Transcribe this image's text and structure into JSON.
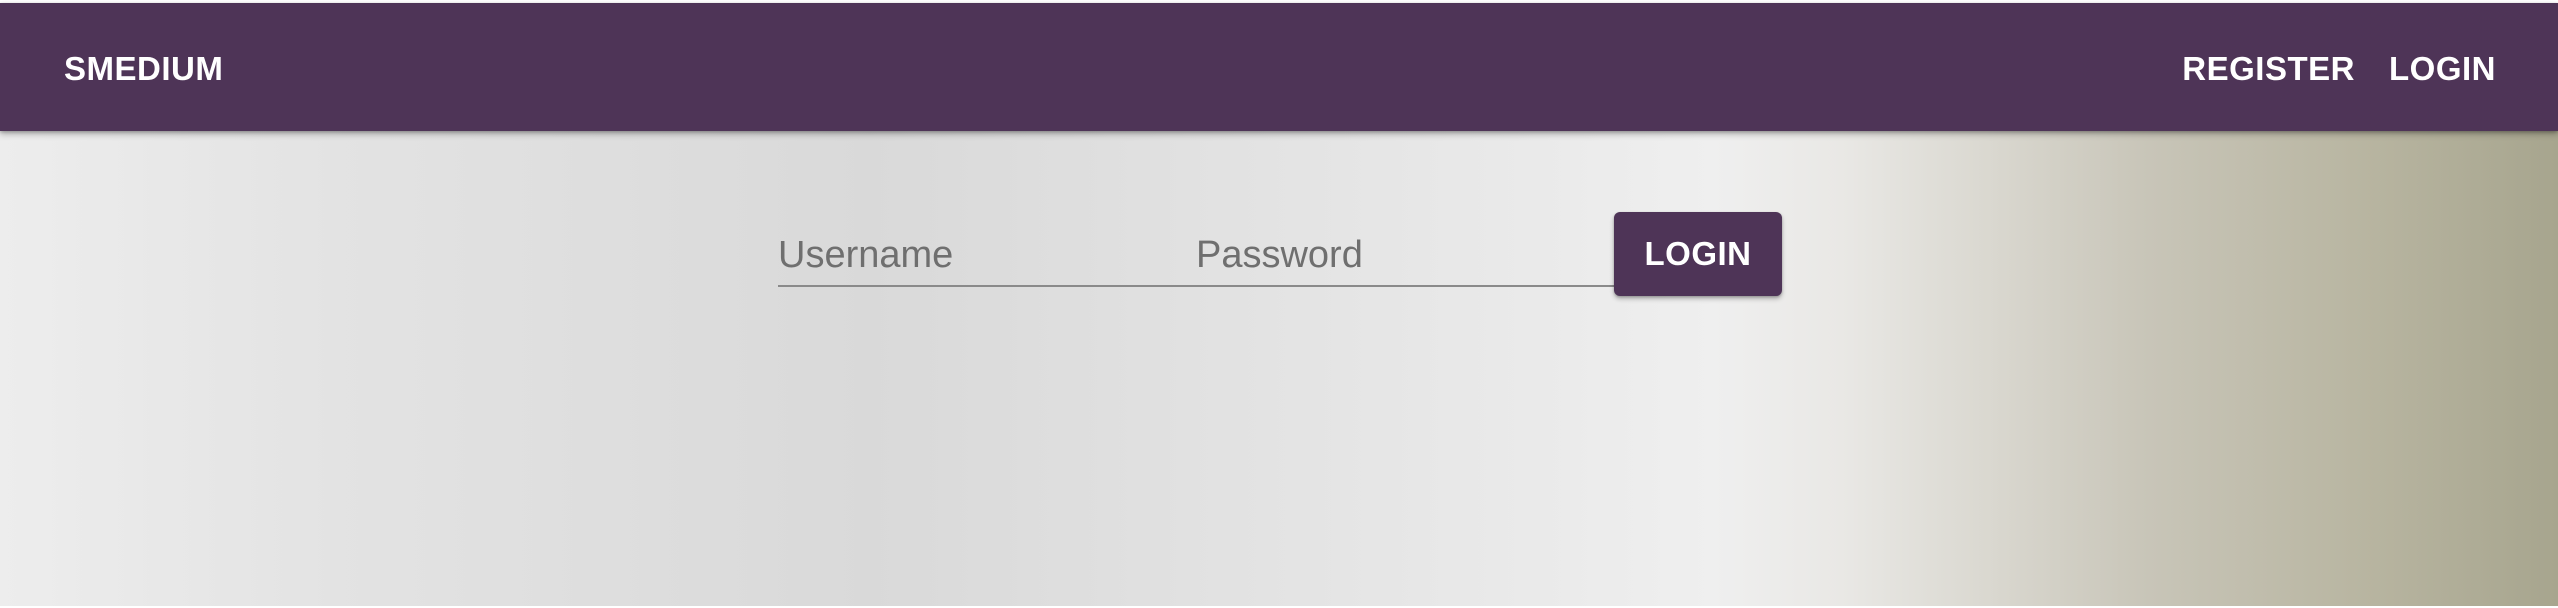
{
  "header": {
    "brand": "SMEDIUM",
    "nav": {
      "register_label": "REGISTER",
      "login_label": "LOGIN"
    }
  },
  "login_form": {
    "username": {
      "placeholder": "Username",
      "value": ""
    },
    "password": {
      "placeholder": "Password",
      "value": ""
    },
    "submit_label": "LOGIN"
  },
  "colors": {
    "primary": "#4e3457",
    "on_primary": "#ffffff",
    "input_underline": "#8a8a8a",
    "placeholder": "#6f6f6f"
  }
}
